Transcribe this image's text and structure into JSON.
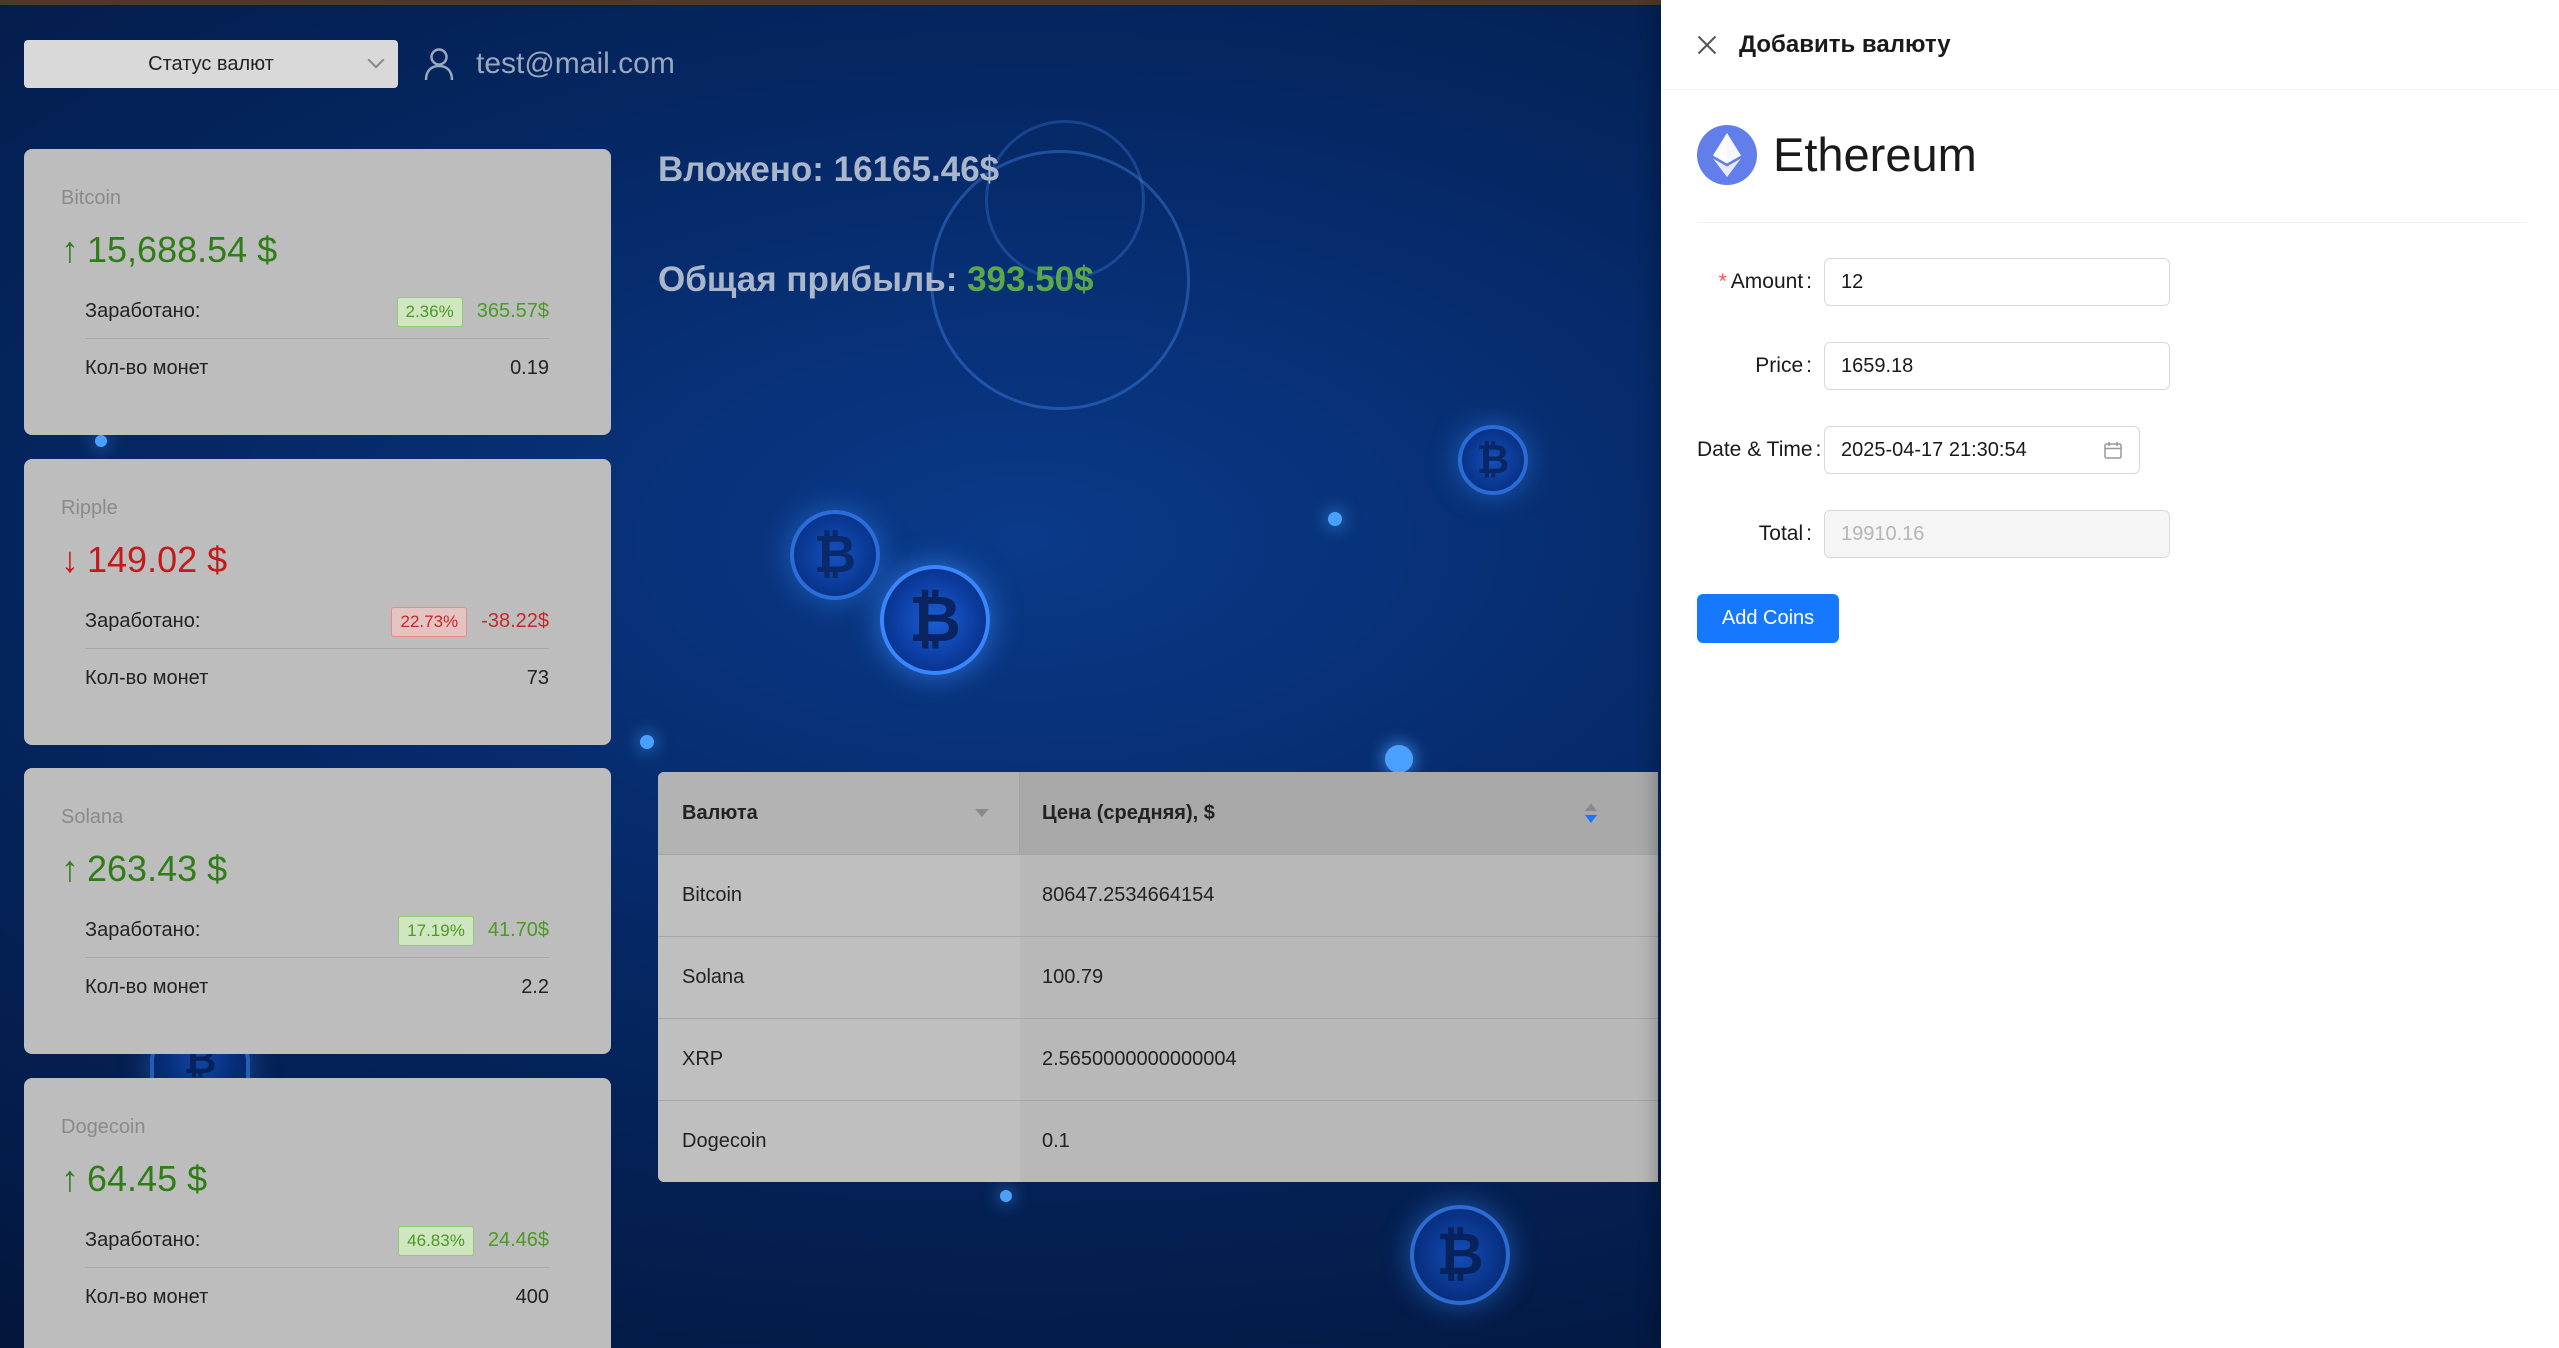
{
  "header": {
    "status_select": "Статус валют",
    "user_email": "test@mail.com"
  },
  "cards": [
    {
      "name": "Bitcoin",
      "price": "15,688.54 $",
      "trend": "up",
      "earned_label": "Заработано:",
      "percent": "2.36%",
      "earned": "365.57$",
      "coins_label": "Кол-во монет",
      "coins": "0.19"
    },
    {
      "name": "Ripple",
      "price": "149.02 $",
      "trend": "down",
      "earned_label": "Заработано:",
      "percent": "22.73%",
      "earned": "-38.22$",
      "coins_label": "Кол-во монет",
      "coins": "73"
    },
    {
      "name": "Solana",
      "price": "263.43 $",
      "trend": "up",
      "earned_label": "Заработано:",
      "percent": "17.19%",
      "earned": "41.70$",
      "coins_label": "Кол-во монет",
      "coins": "2.2"
    },
    {
      "name": "Dogecoin",
      "price": "64.45 $",
      "trend": "up",
      "earned_label": "Заработано:",
      "percent": "46.83%",
      "earned": "24.46$",
      "coins_label": "Кол-во монет",
      "coins": "400"
    }
  ],
  "summary": {
    "invested": "Вложено: 16165.46$",
    "profit_label": "Общая прибыль: ",
    "profit_value": "393.50$"
  },
  "table": {
    "headers": [
      "Валюта",
      "Цена (средняя), $"
    ],
    "rows": [
      [
        "Bitcoin",
        "80647.2534664154"
      ],
      [
        "Solana",
        "100.79"
      ],
      [
        "XRP",
        "2.5650000000000004"
      ],
      [
        "Dogecoin",
        "0.1"
      ]
    ]
  },
  "drawer": {
    "title": "Добавить валюту",
    "coin_name": "Ethereum",
    "form": {
      "amount_label": "Amount",
      "amount_value": "12",
      "price_label": "Price",
      "price_value": "1659.18",
      "datetime_label": "Date & Time",
      "datetime_value": "2025-04-17 21:30:54",
      "total_label": "Total",
      "total_value": "19910.16"
    },
    "submit_label": "Add Coins"
  },
  "colors": {
    "accent": "#1677ff",
    "up": "#2e7d17",
    "down": "#c41a1a",
    "eth": "#627eea"
  }
}
